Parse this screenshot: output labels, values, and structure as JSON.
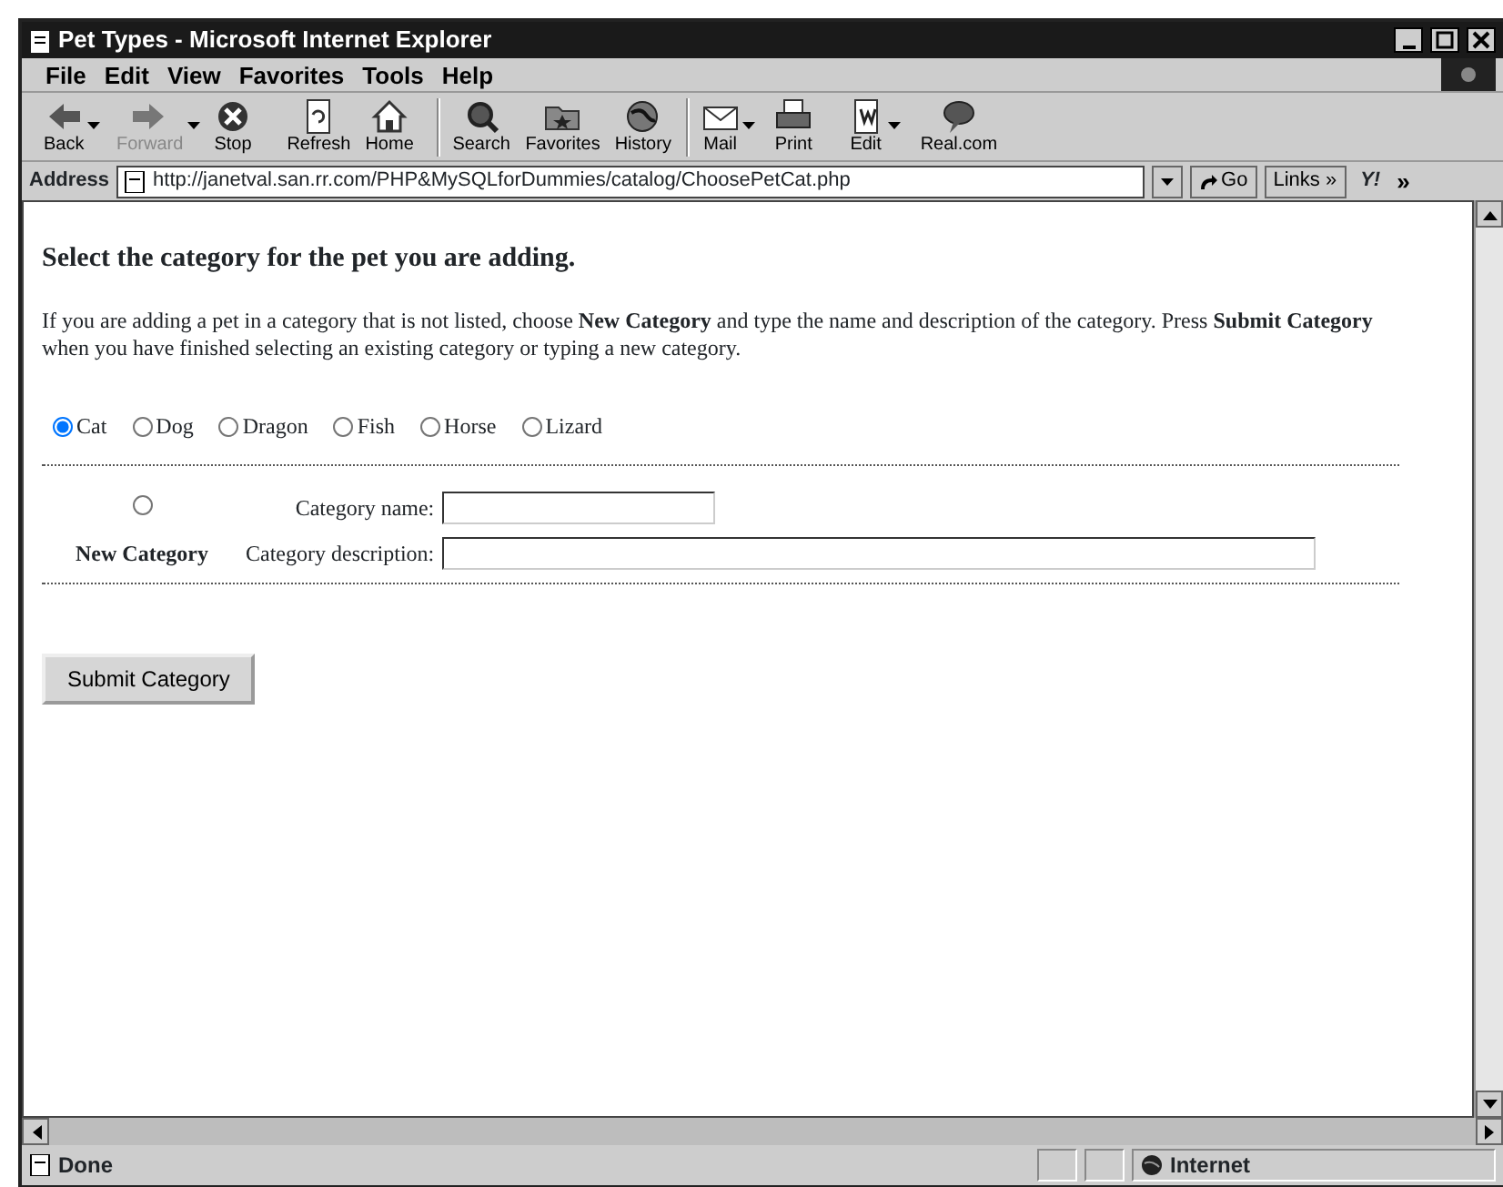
{
  "window": {
    "title": "Pet Types - Microsoft Internet Explorer"
  },
  "menu": [
    "File",
    "Edit",
    "View",
    "Favorites",
    "Tools",
    "Help"
  ],
  "toolbar": [
    {
      "label": "Back",
      "disabled": false,
      "dropdown": true
    },
    {
      "label": "Forward",
      "disabled": true,
      "dropdown": true
    },
    {
      "label": "Stop",
      "disabled": false,
      "dropdown": false
    },
    {
      "label": "Refresh",
      "disabled": false,
      "dropdown": false
    },
    {
      "label": "Home",
      "disabled": false,
      "dropdown": false
    },
    {
      "label": "Search",
      "disabled": false,
      "dropdown": false
    },
    {
      "label": "Favorites",
      "disabled": false,
      "dropdown": false
    },
    {
      "label": "History",
      "disabled": false,
      "dropdown": false
    },
    {
      "label": "Mail",
      "disabled": false,
      "dropdown": true
    },
    {
      "label": "Print",
      "disabled": false,
      "dropdown": false
    },
    {
      "label": "Edit",
      "disabled": false,
      "dropdown": true
    },
    {
      "label": "Real.com",
      "disabled": false,
      "dropdown": false
    }
  ],
  "address_bar": {
    "label": "Address",
    "url": "http://janetval.san.rr.com/PHP&MySQLforDummies/catalog/ChoosePetCat.php",
    "go": "Go",
    "links": "Links »",
    "logo": "Y!",
    "more": "»"
  },
  "page": {
    "heading": "Select the category for the pet you are adding.",
    "instructions": "If you are adding a pet in a category that is not listed, choose **New Category** and type the name and description of the category. Press **Submit Category** when you have finished selecting an existing category or typing a new category.",
    "categories": [
      {
        "label": "Cat",
        "selected": true
      },
      {
        "label": "Dog",
        "selected": false
      },
      {
        "label": "Dragon",
        "selected": false
      },
      {
        "label": "Fish",
        "selected": false
      },
      {
        "label": "Horse",
        "selected": false
      },
      {
        "label": "Lizard",
        "selected": false
      }
    ],
    "new_category": {
      "label": "New Category",
      "selected": false
    },
    "fields": [
      {
        "label": "Category name:",
        "kind": "short"
      },
      {
        "label": "Category description:",
        "kind": "long"
      }
    ],
    "submit": "Submit Category"
  },
  "status_bar": {
    "text": "Done",
    "zone": "Internet"
  }
}
